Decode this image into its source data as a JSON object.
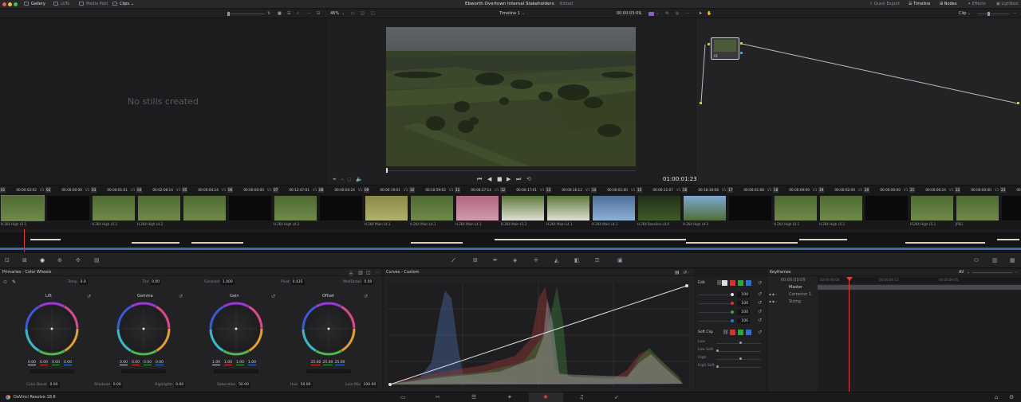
{
  "topbar": {
    "left_tabs": [
      {
        "label": "Gallery",
        "icon": "gallery-icon",
        "active": true
      },
      {
        "label": "LUTs",
        "icon": "lut-icon",
        "active": false
      },
      {
        "label": "Media Pool",
        "icon": "media-pool-icon",
        "active": false
      },
      {
        "label": "Clips",
        "icon": "clips-icon",
        "active": true
      }
    ],
    "project_title": "Ebworth Overtown Internal Stakeholders",
    "project_status": "Edited",
    "right_tabs": [
      {
        "label": "Quick Export",
        "icon": "export-icon",
        "active": false
      },
      {
        "label": "Timeline",
        "icon": "timeline-icon",
        "active": true
      },
      {
        "label": "Nodes",
        "icon": "nodes-icon",
        "active": true
      },
      {
        "label": "Effects",
        "icon": "effects-icon",
        "active": false
      },
      {
        "label": "Lightbox",
        "icon": "lightbox-icon",
        "active": false
      }
    ]
  },
  "viewer_bar": {
    "zoom": "46%",
    "timeline_name": "Timeline 1",
    "timecode": "00:00:03:09",
    "node_mode": "Clip"
  },
  "gallery": {
    "empty_text": "No stills created"
  },
  "viewer": {
    "current_timecode": "01:00:01:23"
  },
  "nodes": {
    "node_label": "01"
  },
  "clips": [
    {
      "num": "01",
      "tc": "00:00:02:02",
      "track": "V1",
      "label": "H.264 High L5.1",
      "thumb": "green"
    },
    {
      "num": "02",
      "tc": "00:00:00:00",
      "track": "V1",
      "label": "",
      "thumb": "black"
    },
    {
      "num": "03",
      "tc": "00:00:01:01",
      "track": "V1",
      "label": "H.264 High L5.1",
      "thumb": "green"
    },
    {
      "num": "04",
      "tc": "00:02:08:14",
      "track": "V1",
      "label": "H.264 High L4.2",
      "thumb": "green"
    },
    {
      "num": "05",
      "tc": "00:00:04:24",
      "track": "V1",
      "label": "",
      "thumb": "green"
    },
    {
      "num": "06",
      "tc": "00:00:00:00",
      "track": "V1",
      "label": "",
      "thumb": "black"
    },
    {
      "num": "07",
      "tc": "00:12:47:01",
      "track": "V1",
      "label": "H.264 High L4.2",
      "thumb": "green"
    },
    {
      "num": "08",
      "tc": "00:00:04:24",
      "track": "V1",
      "label": "",
      "thumb": "black"
    },
    {
      "num": "09",
      "tc": "00:00:19:01",
      "track": "V1",
      "label": "H.264 Main L4.1",
      "thumb": "yellow"
    },
    {
      "num": "10",
      "tc": "00:10:59:02",
      "track": "V1",
      "label": "H.264 Main L4.1",
      "thumb": "green"
    },
    {
      "num": "11",
      "tc": "00:00:27:14",
      "track": "V1",
      "label": "H.264 Main L4.1",
      "thumb": "pink"
    },
    {
      "num": "12",
      "tc": "00:00:17:01",
      "track": "V1",
      "label": "H.264 Main L5.2",
      "thumb": "flower"
    },
    {
      "num": "13",
      "tc": "00:00:16:12",
      "track": "V1",
      "label": "H.264 Main L4.1",
      "thumb": "flower"
    },
    {
      "num": "14",
      "tc": "00:00:01:00",
      "track": "V1",
      "label": "H.264 Main L4.1",
      "thumb": "blue"
    },
    {
      "num": "15",
      "tc": "00:00:11:07",
      "track": "V1",
      "label": "H.264 Baseline L4.0",
      "thumb": "dark"
    },
    {
      "num": "16",
      "tc": "00:18:30:08",
      "track": "V1",
      "label": "H.264 High L4.2",
      "thumb": "sky"
    },
    {
      "num": "17",
      "tc": "00:00:01:08",
      "track": "V1",
      "label": "",
      "thumb": "black"
    },
    {
      "num": "18",
      "tc": "00:00:09:09",
      "track": "V1",
      "label": "H.264 High L5.1",
      "thumb": "green"
    },
    {
      "num": "19",
      "tc": "00:00:02:09",
      "track": "V1",
      "label": "H.264 High L5.1",
      "thumb": "green"
    },
    {
      "num": "20",
      "tc": "00:00:00:00",
      "track": "V1",
      "label": "",
      "thumb": "black"
    },
    {
      "num": "21",
      "tc": "00:00:00:24",
      "track": "V1",
      "label": "H.264 High L5.1",
      "thumb": "green"
    },
    {
      "num": "22",
      "tc": "00:00:00:00",
      "track": "V1",
      "label": "JPEG",
      "thumb": "green"
    },
    {
      "num": "23",
      "tc": "00:00:",
      "track": "",
      "label": "",
      "thumb": "black"
    }
  ],
  "primaries": {
    "title": "Primaries - Color Wheels",
    "top_fields": [
      {
        "label": "Temp",
        "value": "0.0"
      },
      {
        "label": "Tint",
        "value": "0.00"
      },
      {
        "label": "Contrast",
        "value": "1.000"
      },
      {
        "label": "Pivot",
        "value": "0.435"
      },
      {
        "label": "Mid/Detail",
        "value": "0.00"
      }
    ],
    "wheels": [
      {
        "name": "Lift",
        "values": [
          "0.00",
          "0.00",
          "0.00",
          "0.00"
        ]
      },
      {
        "name": "Gamma",
        "values": [
          "0.00",
          "0.00",
          "0.00",
          "0.00"
        ]
      },
      {
        "name": "Gain",
        "values": [
          "1.00",
          "1.00",
          "1.00",
          "1.00"
        ]
      },
      {
        "name": "Offset",
        "values": [
          "25.00",
          "25.00",
          "25.00"
        ]
      }
    ],
    "bottom_fields": [
      {
        "label": "Color Boost",
        "value": "0.00"
      },
      {
        "label": "Shadows",
        "value": "0.00"
      },
      {
        "label": "Highlights",
        "value": "0.00"
      },
      {
        "label": "Saturation",
        "value": "50.00"
      },
      {
        "label": "Hue",
        "value": "50.00"
      },
      {
        "label": "Lum Mix",
        "value": "100.00"
      }
    ]
  },
  "curves": {
    "title": "Curves - Custom",
    "edit_label": "Edit",
    "channel_values": [
      "100",
      "100",
      "100",
      "100"
    ],
    "soft_clip_label": "Soft Clip",
    "soft_clip_rows": [
      "Low",
      "Low Soft",
      "High",
      "High Soft"
    ]
  },
  "keyframes": {
    "title": "Keyframes",
    "filter": "All",
    "timecode": "00:00:03:09",
    "ruler": [
      "00:00:00:00",
      "00:00:04:15",
      "00:00:09:05"
    ],
    "tracks": [
      "Master",
      "Corrector 1",
      "Sizing"
    ]
  },
  "pagebar": {
    "app_name": "DaVinci Resolve 18.6"
  }
}
